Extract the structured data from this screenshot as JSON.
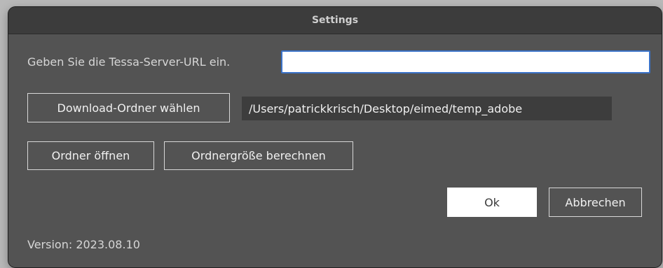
{
  "window": {
    "title": "Settings"
  },
  "server": {
    "label": "Geben Sie die Tessa-Server-URL ein.",
    "value": "",
    "placeholder": ""
  },
  "download": {
    "button_label": "Download-Ordner wählen",
    "path": "/Users/patrickkrisch/Desktop/eimed/temp_adobe"
  },
  "folder_actions": {
    "open_label": "Ordner öffnen",
    "compute_size_label": "Ordnergröße berechnen"
  },
  "dialog": {
    "ok_label": "Ok",
    "cancel_label": "Abbrechen"
  },
  "footer": {
    "version_text": "Version: 2023.08.10"
  },
  "colors": {
    "window_bg": "#535353",
    "titlebar_bg": "#3c3c3c",
    "input_focus_border": "#3a72c8",
    "path_bg": "#3d3d3d"
  }
}
